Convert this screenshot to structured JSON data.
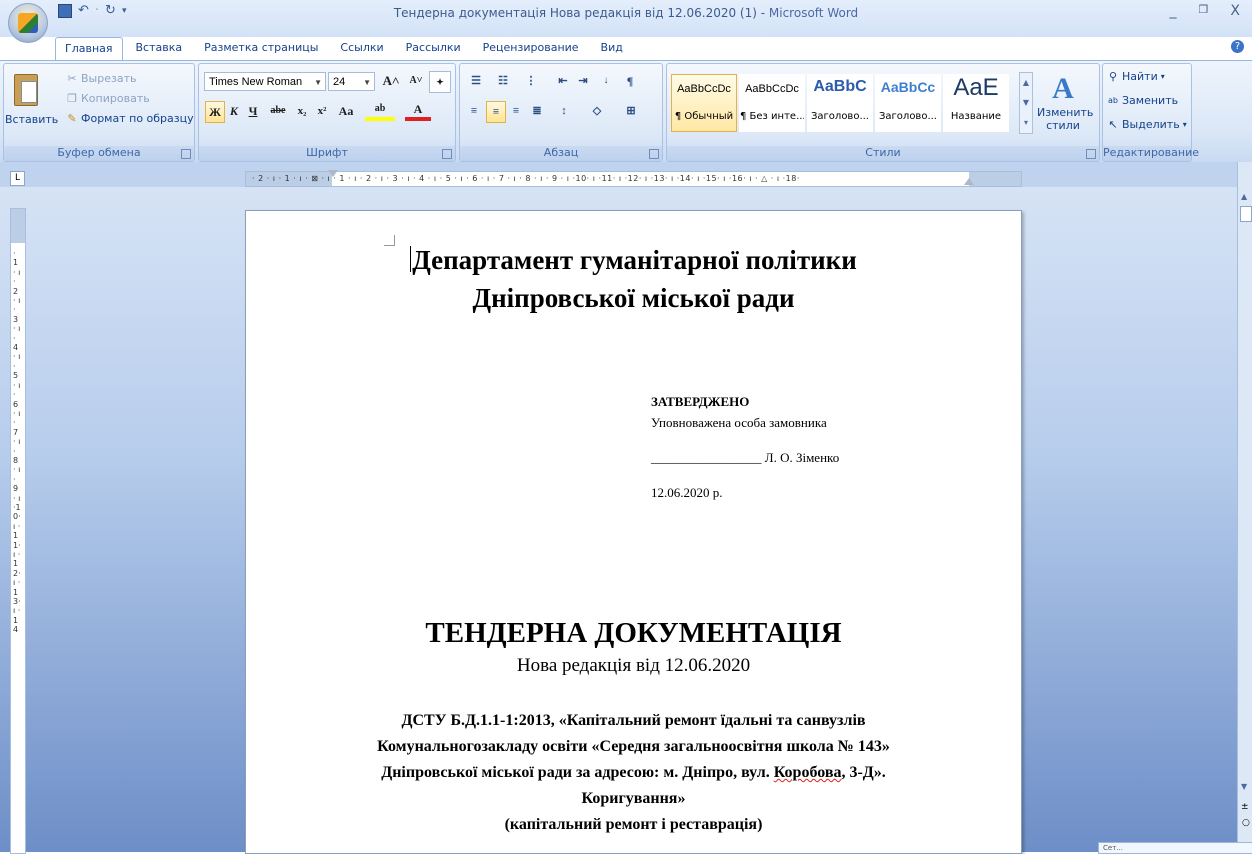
{
  "window": {
    "title": "Тендерна документація Нова редакція від 12.06.2020 (1)",
    "title_sep": " - ",
    "app": "Microsoft Word",
    "controls": [
      "_",
      "❐",
      "X"
    ]
  },
  "tabs": [
    {
      "label": "Главная",
      "active": true
    },
    {
      "label": "Вставка"
    },
    {
      "label": "Разметка страницы"
    },
    {
      "label": "Ссылки"
    },
    {
      "label": "Рассылки"
    },
    {
      "label": "Рецензирование"
    },
    {
      "label": "Вид"
    }
  ],
  "ribbon": {
    "clipboard": {
      "paste": "Вставить",
      "cut": "Вырезать",
      "copy": "Копировать",
      "format_painter": "Формат по образцу",
      "label": "Буфер обмена"
    },
    "font": {
      "family": "Times New Roman",
      "size": "24",
      "label": "Шрифт",
      "bold": "Ж",
      "italic": "К",
      "underline": "Ч",
      "strike": "abe",
      "subscript": "x₂",
      "superscript": "x²",
      "change_case": "Aa",
      "grow": "A˄",
      "shrink": "A˅",
      "highlight": "ab",
      "font_color": "A",
      "highlight_color": "#ffff00",
      "font_color_value": "#e02020"
    },
    "paragraph": {
      "label": "Абзац"
    },
    "styles": {
      "label": "Стили",
      "items": [
        {
          "sample": "AaBbCcDc",
          "name": "¶ Обычный",
          "selected": true
        },
        {
          "sample": "AaBbCcDc",
          "name": "¶ Без инте..."
        },
        {
          "sample": "AaBbC",
          "name": "Заголово..."
        },
        {
          "sample": "AaBbCc",
          "name": "Заголово..."
        },
        {
          "sample": "AaE",
          "name": "Название"
        }
      ],
      "change_styles": "Изменить стили"
    },
    "editing": {
      "label": "Редактирование",
      "find": "Найти",
      "replace": "Заменить",
      "select": "Выделить"
    }
  },
  "ruler": {
    "numbers": "· 2 · ı · 1 · ı · ⊠ · ı · 1 · ı · 2 · ı · 3 · ı · 4 · ı · 5 · ı · 6 · ı · 7 · ı · 8 · ı · 9 · ı ·10· ı ·11· ı ·12· ı ·13· ı ·14· ı ·15· ı ·16· ı · △ · ı ·18·",
    "vertical": "· 1 · ı · 2 · ı · 3 · ı · 4 · ı · 5 · ı · 6 · ı · 7 · ı · 8 · ı · 9 · ı ·10· ı ·11· ı ·12· ı ·13· ı ·14"
  },
  "document": {
    "dept_line1": "Департамент гуманітарної політики",
    "dept_line2": "Дніпровської міської ради",
    "approved": "ЗАТВЕРДЖЕНО",
    "authorized": "Уповноважена особа замовника",
    "signature_line": "_________________",
    "signatory": " Л. О. Зіменко",
    "date": "12.06.2020 р.",
    "title": "ТЕНДЕРНА ДОКУМЕНТАЦІЯ",
    "subtitle": "Нова редакція від 12.06.2020",
    "body_line1": "ДСТУ Б.Д.1.1-1:2013, «Капітальний ремонт їдальні та санвузлів",
    "body_line2": "Комунальногозакладу освіти  «Середня загальноосвітня школа № 143»",
    "body_line3a": "Дніпровської міської ради за адресою: м. Дніпро, вул. ",
    "body_line3_word": "Коробова",
    "body_line3b": ", 3-Д».",
    "body_line4": "Коригування»",
    "body_line5": "(капітальний ремонт і реставрація)"
  },
  "status_tooltip": "Сет..."
}
